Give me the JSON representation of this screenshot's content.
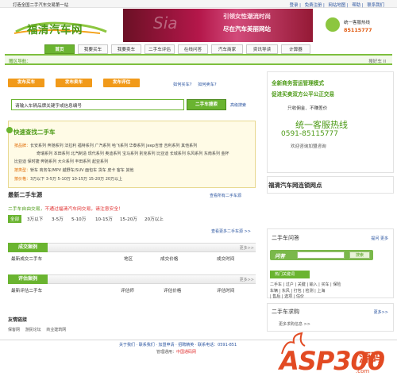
{
  "topbar": {
    "left": "打造全国二手汽车交易第一站",
    "links": [
      "登录",
      "免费注册",
      "网站地图",
      "帮助",
      "联系我们"
    ]
  },
  "logo": {
    "text": "福清汽车网"
  },
  "banner": {
    "text1": "引领女性潮流时尚",
    "text2": "尽在汽车美丽网站",
    "deco": "Sia"
  },
  "hotline": {
    "label": "统一客服热线",
    "number": "85115777"
  },
  "nav": {
    "items": [
      "首页",
      "我要买车",
      "我要卖车",
      "二手车评估",
      "在线问答",
      "汽车商家",
      "资讯导读",
      "计算器"
    ]
  },
  "subnav": {
    "left": "赠区导航：",
    "right": "搜好车 II"
  },
  "buttons": {
    "buy": "发布买车",
    "sell": "发布卖车",
    "eval": "发布评估"
  },
  "how": {
    "buy": "如何买车?",
    "sell": "如何卖车?"
  },
  "search": {
    "placeholder": "请输入车辆品牌关键字或信息编号",
    "button": "二手车搜索",
    "advanced": "高级搜索"
  },
  "quick": {
    "title": "快速查找二手车",
    "rows": [
      {
        "label": "按品牌：",
        "text": "长安系列 奔驰系列 法拉利 福特系列 广汽系列 哈飞系列 华泰系列 Jeep吉普 吉利系列 其他系列"
      },
      {
        "label": "",
        "text": "奇瑞系列 本田系列 北汽制造 现代系列 奥迪系列 宝马系列 别克系列 比亚迪 长城系列 东风系列 东南系列 金杯"
      },
      {
        "label": "",
        "text": "比亚迪 保时捷 奔驰系列 大众系列 丰田系列 起亚系列"
      },
      {
        "label": "按类型：",
        "text": "轿车 商务车/MPV 越野车/SUV 面包车 货车 皮卡 客车 其他"
      },
      {
        "label": "按价格：",
        "text": "3万以下 3-5万 5-10万 10-15万 15-20万 20万以上"
      }
    ]
  },
  "newest": {
    "title": "最新二手车源",
    "more": "查看所有二手车源",
    "intro": "二手车自由交易，",
    "intro_red": "不通过福清汽车网交易，请注意安全！"
  },
  "price_tabs": [
    "全部",
    "3万以下",
    "3-5万",
    "5-10万",
    "10-15万",
    "15-20万",
    "20万以上"
  ],
  "more_used": "查看更多二手车源 >>",
  "deals": {
    "label": "成交案例",
    "more": "更多>>",
    "cols": [
      "最新成交二手车",
      "地区",
      "成交价格",
      "成交时间"
    ]
  },
  "eval_cases": {
    "label": "评估案例",
    "more": "更多>>",
    "cols": [
      "最新评估二手车",
      "评估师",
      "评估价格",
      "评估时间"
    ]
  },
  "friends": {
    "title": "友情链接",
    "links": [
      "保客网",
      "游民论坛",
      "商业建筑网"
    ]
  },
  "footer": {
    "line1": "关于我们 · 联系我们 · 加盟申请 · 招聘精英 · 联系电话：0591-851",
    "line2_prefix": "管理通用：",
    "line2_red": "中国通码网"
  },
  "right": {
    "news1": "全新商务营运管理模式",
    "news2": "促进买卖双方公平公正交易",
    "news3": "只收佣金、不赚差价",
    "news4": "统一客服热线",
    "news5": "0591-85115777",
    "news6": "欢迎咨询加盟咨询",
    "network": "福清汽车网连锁网点",
    "qa": {
      "title": "二手车问答",
      "links": [
        "提问",
        "更多"
      ],
      "w": "问答",
      "search": "搜索"
    },
    "hot_title": "热门关键词",
    "tags": [
      "二手车 | 过户 | 关键 | 输入 | 买车 | 保险",
      "车辆 | 东风 | 打包 | 检测 | 上海",
      "| 售后 | 选项 | 估价"
    ],
    "purchase": {
      "title": "二手车求购",
      "more": "更多>>",
      "item": "更多求购信息 >>"
    }
  },
  "watermark": {
    "main": "ASP300",
    "cn": "源码",
    "domain": ".com"
  }
}
